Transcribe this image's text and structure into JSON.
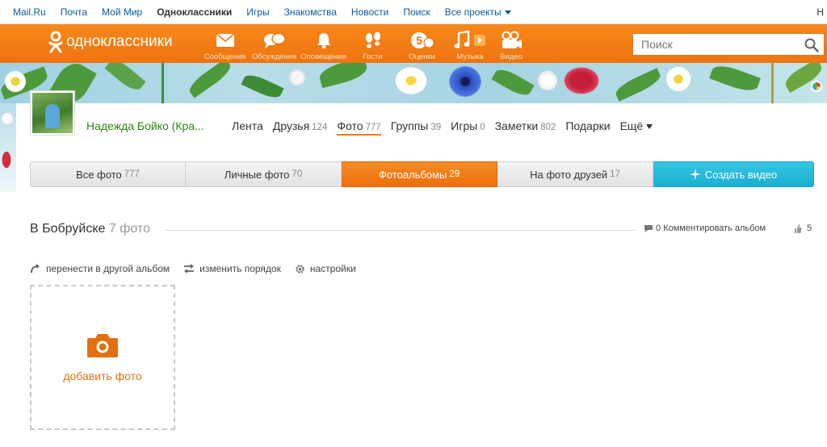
{
  "topbar": {
    "links": [
      {
        "label": "Mail.Ru",
        "bold": false
      },
      {
        "label": "Почта",
        "bold": false
      },
      {
        "label": "Мой Мир",
        "bold": false
      },
      {
        "label": "Одноклассники",
        "bold": true
      },
      {
        "label": "Игры",
        "bold": false
      },
      {
        "label": "Знакомства",
        "bold": false
      },
      {
        "label": "Новости",
        "bold": false
      },
      {
        "label": "Поиск",
        "bold": false
      },
      {
        "label": "Все проекты",
        "bold": false
      }
    ],
    "right_text": "Н"
  },
  "header": {
    "logo_text": "одноклассники",
    "nav": [
      {
        "label": "Сообщения",
        "icon": "envelope-icon"
      },
      {
        "label": "Обсуждения",
        "icon": "chat-bubbles-icon"
      },
      {
        "label": "Оповещения",
        "icon": "bell-icon"
      },
      {
        "label": "Гости",
        "icon": "footprints-icon"
      },
      {
        "label": "Оценки",
        "icon": "rating-five-icon"
      },
      {
        "label": "Музыка",
        "icon": "music-note-icon"
      },
      {
        "label": "Видео",
        "icon": "video-camera-icon"
      }
    ],
    "search_placeholder": "Поиск"
  },
  "profile": {
    "name": "Надежда Бойко (Кра...",
    "nav": [
      {
        "label": "Лента",
        "count": ""
      },
      {
        "label": "Друзья",
        "count": "124"
      },
      {
        "label": "Фото",
        "count": "777"
      },
      {
        "label": "Группы",
        "count": "39"
      },
      {
        "label": "Игры",
        "count": "0"
      },
      {
        "label": "Заметки",
        "count": "802"
      },
      {
        "label": "Подарки",
        "count": ""
      },
      {
        "label": "Ещё",
        "count": ""
      }
    ]
  },
  "photo_tabs": [
    {
      "label": "Все фото",
      "count": "777"
    },
    {
      "label": "Личные фото",
      "count": "70"
    },
    {
      "label": "Фотоальбомы",
      "count": "29"
    },
    {
      "label": "На фото друзей",
      "count": "17"
    },
    {
      "label": "Создать видео",
      "count": ""
    }
  ],
  "album": {
    "title": "В Бобруйске",
    "count": "7 фото",
    "comments_count": "0",
    "comment_label": "Комментировать альбом",
    "likes_count": "5"
  },
  "actions": [
    {
      "label": "перенести в другой альбом",
      "icon": "move-arrow-icon"
    },
    {
      "label": "изменить порядок",
      "icon": "reorder-arrows-icon"
    },
    {
      "label": "настройки",
      "icon": "gear-icon"
    }
  ],
  "add_photo": {
    "label": "добавить фото"
  },
  "colors": {
    "accent": "#f07c17",
    "link": "#0a5a9c",
    "username": "#2a8a12",
    "create": "#1fb6d6"
  }
}
